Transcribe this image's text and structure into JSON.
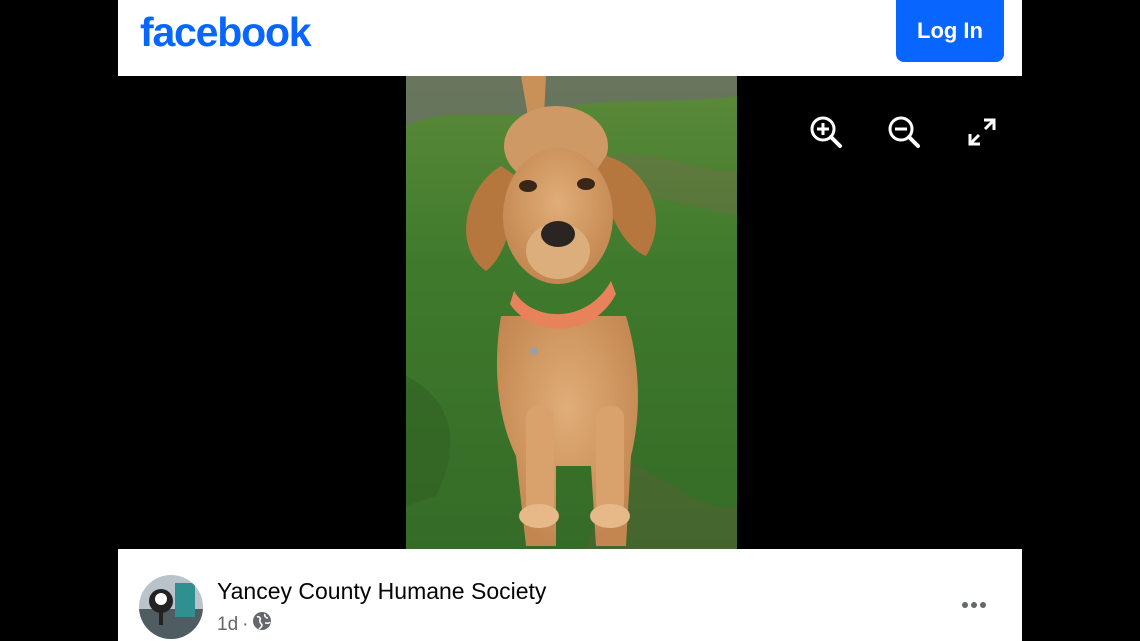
{
  "header": {
    "logo_text": "facebook",
    "login_label": "Log In",
    "brand_color": "#0866ff"
  },
  "viewer": {
    "photo_subject": "Redbone coonhound dog with orange collar sitting on grass",
    "tools": [
      {
        "name": "zoom-in-icon"
      },
      {
        "name": "zoom-out-icon"
      },
      {
        "name": "fullscreen-icon"
      }
    ]
  },
  "post": {
    "page_name": "Yancey County Humane Society",
    "time": "1d",
    "separator": "·",
    "privacy_icon": "globe-icon",
    "more_icon": "more-options-icon"
  }
}
